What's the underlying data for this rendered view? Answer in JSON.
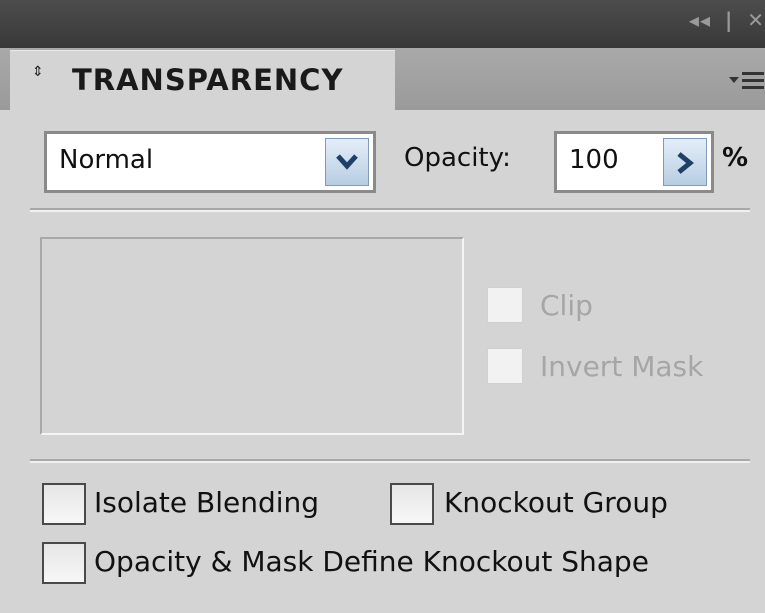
{
  "titlebar": {
    "collapse_glyph": "◂◂",
    "separator": "|",
    "close_glyph": "✕"
  },
  "tab": {
    "title": "TRANSPARENCY",
    "arrows_glyph": "⇕"
  },
  "blend_mode": {
    "selected": "Normal"
  },
  "opacity": {
    "label": "Opacity:",
    "value": "100",
    "unit": "%"
  },
  "mask": {
    "clip_label": "Clip",
    "invert_mask_label": "Invert Mask"
  },
  "options": {
    "isolate_blending_label": "Isolate Blending",
    "knockout_group_label": "Knockout Group",
    "opacity_mask_knockout_label": "Opacity & Mask Define Knockout Shape"
  },
  "icons": {
    "collapse": "double-left-arrow-icon",
    "close": "close-icon",
    "panel_menu": "panel-menu-icon",
    "dropdown": "chevron-down-icon",
    "stepper": "chevron-right-icon",
    "tab_arrows": "up-down-arrows-icon"
  },
  "colors": {
    "panel_bg": "#d4d4d4",
    "titlebar_bg": "#3f3f3f",
    "button_blue": "#b8cde3"
  }
}
